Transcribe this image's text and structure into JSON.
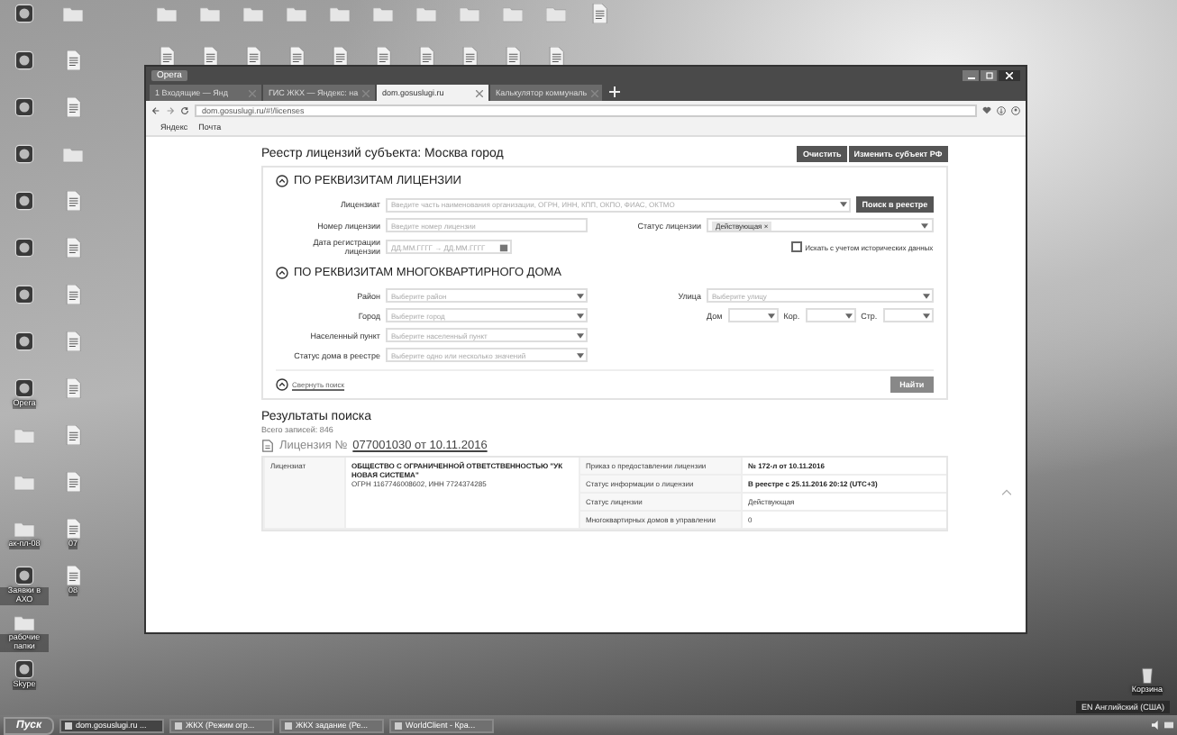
{
  "desktop": {
    "top_icons": [
      {
        "kind": "folder"
      },
      {
        "kind": "folder"
      },
      {
        "kind": "folder"
      },
      {
        "kind": "folder"
      },
      {
        "kind": "folder"
      },
      {
        "kind": "folder"
      },
      {
        "kind": "folder"
      },
      {
        "kind": "folder"
      },
      {
        "kind": "folder"
      },
      {
        "kind": "folder"
      },
      {
        "kind": "file"
      }
    ],
    "second_row_icons": [
      {
        "kind": "file"
      },
      {
        "kind": "file"
      },
      {
        "kind": "file"
      },
      {
        "kind": "file"
      },
      {
        "kind": "file"
      },
      {
        "kind": "file"
      },
      {
        "kind": "file"
      },
      {
        "kind": "file"
      },
      {
        "kind": "file"
      },
      {
        "kind": "file"
      }
    ],
    "left_icons": [
      {
        "kind": "app"
      },
      {
        "kind": "app"
      },
      {
        "kind": "app"
      },
      {
        "kind": "app"
      },
      {
        "kind": "app"
      },
      {
        "kind": "app"
      },
      {
        "kind": "app"
      },
      {
        "kind": "app"
      },
      {
        "kind": "app",
        "label": "Opera"
      },
      {
        "kind": "folder"
      },
      {
        "kind": "folder"
      },
      {
        "kind": "folder",
        "label": "ак-пл-08"
      },
      {
        "kind": "app",
        "label": "Заявки в АХО"
      },
      {
        "kind": "folder",
        "label": "рабочие папки"
      },
      {
        "kind": "app",
        "label": "Skype"
      },
      {
        "kind": "folder"
      },
      {
        "kind": "file"
      },
      {
        "kind": "file"
      },
      {
        "kind": "folder"
      },
      {
        "kind": "file"
      },
      {
        "kind": "file"
      },
      {
        "kind": "file"
      },
      {
        "kind": "file"
      },
      {
        "kind": "file"
      },
      {
        "kind": "file"
      },
      {
        "kind": "file"
      },
      {
        "kind": "file",
        "label": "07"
      },
      {
        "kind": "file",
        "label": "08"
      }
    ],
    "recycle_bin": {
      "label": "Корзина"
    },
    "language_bar": {
      "label": "EN Английский (США)"
    }
  },
  "browser": {
    "title": "Opera",
    "tabs": [
      {
        "label": "1 Входящие — Янд",
        "selected": false
      },
      {
        "label": "ГИС ЖКХ — Яндекс: на",
        "selected": false
      },
      {
        "label": "dom.gosuslugi.ru",
        "selected": true
      },
      {
        "label": "Калькулятор коммуналь",
        "selected": false
      }
    ],
    "address": "dom.gosuslugi.ru/#!/licenses",
    "bookmarks": [
      "Яндекс",
      "Почта"
    ]
  },
  "page": {
    "title": "Реестр лицензий субъекта: Москва город",
    "header_buttons": [
      "Очистить",
      "Изменить субъект РФ"
    ],
    "license_section": {
      "title": "ПО РЕКВИЗИТАМ ЛИЦЕНЗИИ",
      "licensee": {
        "label": "Лицензиат",
        "placeholder": "Введите часть наименования организации, ОГРН, ИНН, КПП, ОКПО, ФИАС, ОКТМО"
      },
      "search_button": "Поиск в реестре",
      "number": {
        "label": "Номер лицензии",
        "placeholder": "Введите номер лицензии"
      },
      "status": {
        "label": "Статус лицензии",
        "chips": [
          {
            "label": "Действующая",
            "remove": "×"
          }
        ]
      },
      "date": {
        "label": "Дата регистрации лицензии",
        "placeholder": "ДД.ММ.ГГГГ → ДД.ММ.ГГГГ"
      },
      "history": {
        "label": "Искать с учетом исторических данных",
        "checked": false
      }
    },
    "house_section": {
      "title": "ПО РЕКВИЗИТАМ МНОГОКВАРТИРНОГО ДОМА",
      "left_fields": [
        {
          "label": "Район",
          "placeholder": "Выберите район"
        },
        {
          "label": "Город",
          "placeholder": "Выберите город"
        },
        {
          "label": "Населенный пункт",
          "placeholder": "Выберите населенный пункт"
        },
        {
          "label": "Статус дома в реестре",
          "placeholder": "Выберите одно или несколько значений"
        }
      ],
      "street": {
        "label": "Улица",
        "placeholder": "Выберите улицу"
      },
      "house_parts": [
        {
          "label": "Дом"
        },
        {
          "label": "Кор."
        },
        {
          "label": "Стр."
        }
      ]
    },
    "collapse_link": "Свернуть поиск",
    "find_button": "Найти",
    "results": {
      "title": "Результаты поиска",
      "count": "Всего записей: 846",
      "license": {
        "prefix": "Лицензия №",
        "number": "077001030 от 10.11.2016",
        "licensee_label": "Лицензиат",
        "org_name": "ОБЩЕСТВО С ОГРАНИЧЕННОЙ ОТВЕТСТВЕННОСТЬЮ \"УК НОВАЯ СИСТЕМА\"",
        "org_ids": "ОГРН 1167746008602, ИНН 7724374285",
        "details": [
          {
            "label": "Приказ о предоставлении лицензии",
            "value": "№ 172-л от 10.11.2016",
            "bold": true
          },
          {
            "label": "Статус информации о лицензии",
            "value": "В реестре с 25.11.2016 20:12 (UTC+3)",
            "bold": true
          },
          {
            "label": "Статус лицензии",
            "value": "Действующая",
            "bold": false
          },
          {
            "label": "Многоквартирных домов в управлении",
            "value": "0",
            "bold": false
          }
        ]
      }
    }
  },
  "taskbar": {
    "start": "Пуск",
    "tasks": [
      {
        "label": "dom.gosuslugi.ru ...",
        "selected": true
      },
      {
        "label": "ЖКХ (Режим огр...",
        "selected": false
      },
      {
        "label": "ЖКХ задание (Ре...",
        "selected": false
      },
      {
        "label": "WorldClient - Кра...",
        "selected": false
      }
    ]
  }
}
